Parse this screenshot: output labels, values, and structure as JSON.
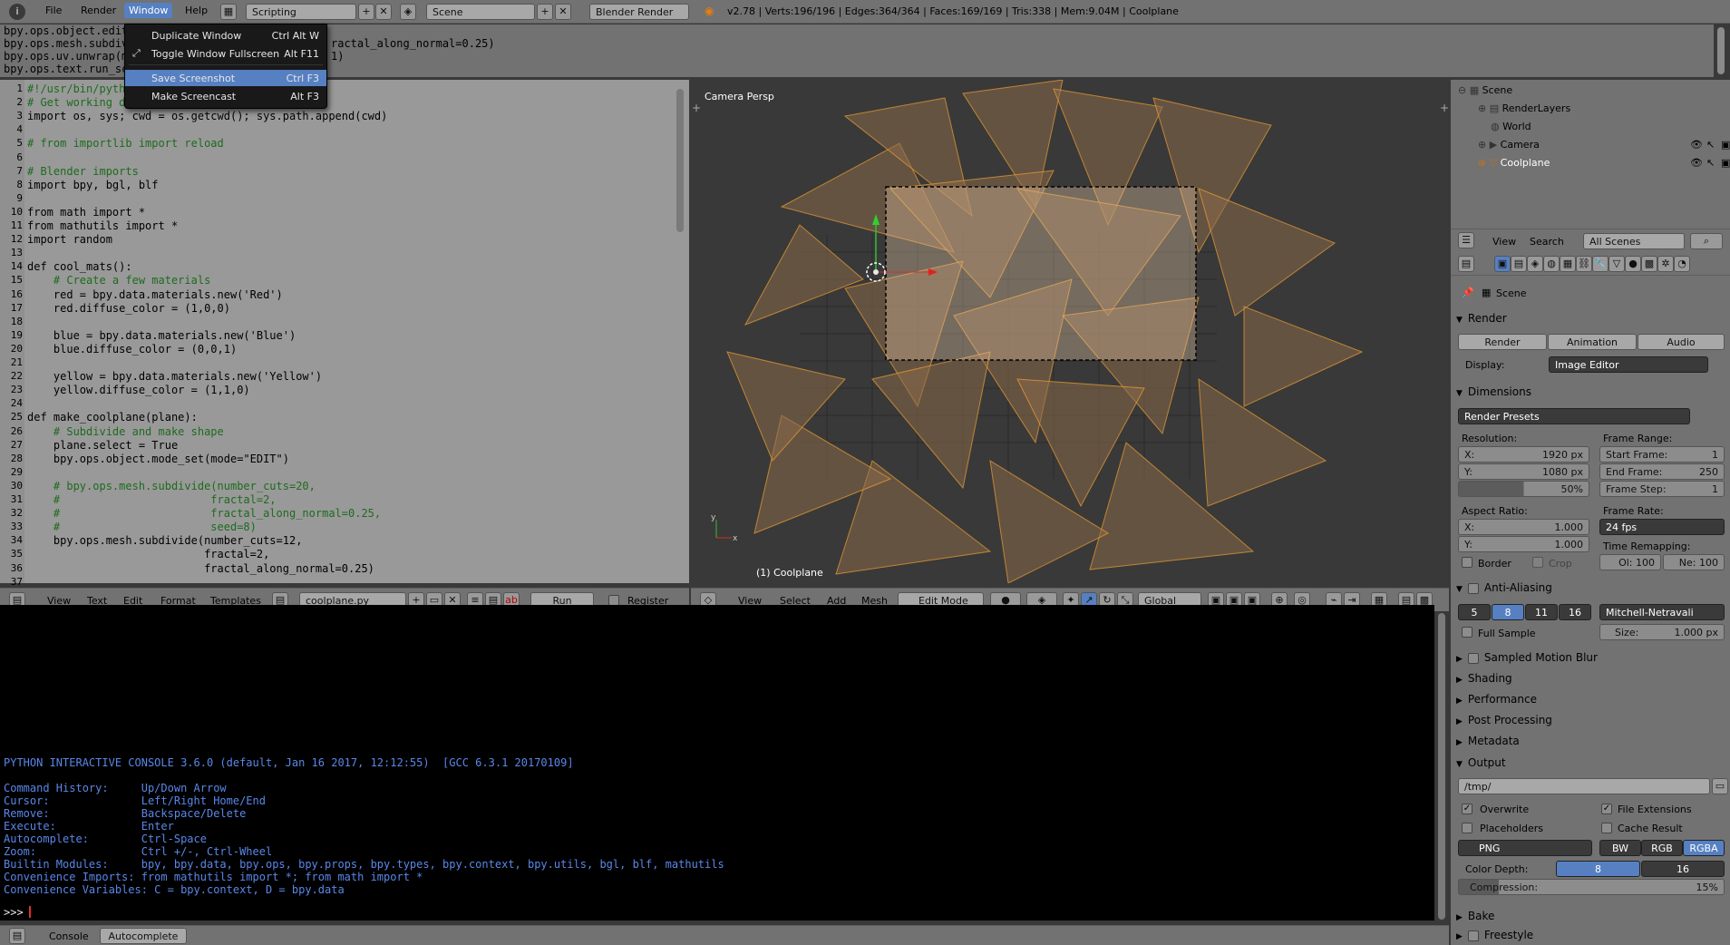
{
  "topbar": {
    "menus": [
      "File",
      "Render",
      "Window",
      "Help"
    ],
    "layout": "Scripting",
    "scene": "Scene",
    "engine": "Blender Render",
    "stats": "v2.78 | Verts:196/196 | Edges:364/364 | Faces:169/169 | Tris:338 | Mem:9.04M | Coolplane"
  },
  "info_log": [
    "bpy.ops.object.edit",
    "bpy.ops.mesh.subdiv",
    "bpy.ops.uv.unwrap(m",
    "bpy.ops.text.run_sc"
  ],
  "info_log_tail": [
    "ractal_along_normal=0.25)",
    "1)"
  ],
  "window_menu": {
    "items": [
      {
        "label": "Duplicate Window",
        "shortcut": "Ctrl Alt W"
      },
      {
        "label": "Toggle Window Fullscreen",
        "shortcut": "Alt F11"
      },
      {
        "label": "Save Screenshot",
        "shortcut": "Ctrl F3"
      },
      {
        "label": "Make Screencast",
        "shortcut": "Alt F3"
      }
    ]
  },
  "text_editor": {
    "lines": [
      "#!/usr/bin/pyth",
      "# Get working d",
      "import os, sys; cwd = os.getcwd(); sys.path.append(cwd)",
      "",
      "# from importlib import reload",
      "",
      "# Blender imports",
      "import bpy, bgl, blf",
      "",
      "from math import *",
      "from mathutils import *",
      "import random",
      "",
      "def cool_mats():",
      "    # Create a few materials",
      "    red = bpy.data.materials.new('Red')",
      "    red.diffuse_color = (1,0,0)",
      "",
      "    blue = bpy.data.materials.new('Blue')",
      "    blue.diffuse_color = (0,0,1)",
      "",
      "    yellow = bpy.data.materials.new('Yellow')",
      "    yellow.diffuse_color = (1,1,0)",
      "",
      "def make_coolplane(plane):",
      "    # Subdivide and make shape",
      "    plane.select = True",
      "    bpy.ops.object.mode_set(mode=\"EDIT\")",
      "",
      "    # bpy.ops.mesh.subdivide(number_cuts=20,",
      "    #                       fractal=2,",
      "    #                       fractal_along_normal=0.25,",
      "    #                       seed=8)",
      "    bpy.ops.mesh.subdivide(number_cuts=12,",
      "                           fractal=2,",
      "                           fractal_along_normal=0.25)",
      ""
    ],
    "line_numbers": [
      "1",
      "2",
      "3",
      "4",
      "5",
      "6",
      "7",
      "8",
      "9",
      "10",
      "11",
      "12",
      "13",
      "14",
      "15",
      "16",
      "17",
      "18",
      "19",
      "20",
      "21",
      "22",
      "23",
      "24",
      "25",
      "26",
      "27",
      "28",
      "29",
      "30",
      "31",
      "32",
      "33",
      "34",
      "35",
      "36",
      "37"
    ],
    "header": {
      "menus": [
        "View",
        "Text",
        "Edit",
        "Format",
        "Templates"
      ],
      "filename": "coolplane.py",
      "run_script": "Run Script",
      "register": "Register"
    }
  },
  "viewport": {
    "label": "Camera Persp",
    "object_label": "(1) Coolplane",
    "header": {
      "menus": [
        "View",
        "Select",
        "Add",
        "Mesh"
      ],
      "mode": "Edit Mode",
      "orientation": "Global"
    }
  },
  "console": {
    "lines": [
      "PYTHON INTERACTIVE CONSOLE 3.6.0 (default, Jan 16 2017, 12:12:55)  [GCC 6.3.1 20170109]",
      "",
      "Command History:     Up/Down Arrow",
      "Cursor:              Left/Right Home/End",
      "Remove:              Backspace/Delete",
      "Execute:             Enter",
      "Autocomplete:        Ctrl-Space",
      "Zoom:                Ctrl +/-, Ctrl-Wheel",
      "Builtin Modules:     bpy, bpy.data, bpy.ops, bpy.props, bpy.types, bpy.context, bpy.utils, bgl, blf, mathutils",
      "Convenience Imports: from mathutils import *; from math import *",
      "Convenience Variables: C = bpy.context, D = bpy.data"
    ],
    "prompt": ">>> ",
    "header": {
      "console": "Console",
      "autocomplete": "Autocomplete"
    }
  },
  "outliner": {
    "items": [
      "Scene",
      "RenderLayers",
      "World",
      "Camera",
      "Coolplane"
    ],
    "header": {
      "view": "View",
      "search": "Search",
      "filter": "All Scenes"
    }
  },
  "properties": {
    "context": "Scene",
    "render_section": "Render",
    "render_buttons": [
      "Render",
      "Animation",
      "Audio"
    ],
    "display_label": "Display:",
    "display_value": "Image Editor",
    "dimensions": "Dimensions",
    "render_presets": "Render Presets",
    "resolution_label": "Resolution:",
    "res_x": "X:",
    "res_x_val": "1920 px",
    "res_y": "Y:",
    "res_y_val": "1080 px",
    "res_pct": "50%",
    "frame_range_label": "Frame Range:",
    "start_frame": "Start Frame:",
    "start_val": "1",
    "end_frame": "End Frame:",
    "end_val": "250",
    "frame_step": "Frame Step:",
    "step_val": "1",
    "aspect_label": "Aspect Ratio:",
    "aspect_x_val": "1.000",
    "aspect_y_val": "1.000",
    "frame_rate_label": "Frame Rate:",
    "fps": "24 fps",
    "time_remap_label": "Time Remapping:",
    "ol": "Ol:",
    "ol_val": "100",
    "ne": "Ne:",
    "ne_val": "100",
    "border": "Border",
    "crop": "Crop",
    "anti_aliasing": "Anti-Aliasing",
    "aa_samples": [
      "5",
      "8",
      "11",
      "16"
    ],
    "aa_filter": "Mitchell-Netravali",
    "full_sample": "Full Sample",
    "size_label": "Size:",
    "size_val": "1.000 px",
    "collapsed": [
      "Sampled Motion Blur",
      "Shading",
      "Performance",
      "Post Processing",
      "Metadata"
    ],
    "output": "Output",
    "output_path": "/tmp/",
    "overwrite": "Overwrite",
    "file_ext": "File Extensions",
    "placeholders": "Placeholders",
    "cache_result": "Cache Result",
    "format": "PNG",
    "color_modes": [
      "BW",
      "RGB",
      "RGBA"
    ],
    "color_depth_label": "Color Depth:",
    "depth_8": "8",
    "depth_16": "16",
    "compression": "Compression:",
    "compression_val": "15%",
    "compression_level": 0.15,
    "bake": "Bake",
    "freestyle": "Freestyle"
  },
  "colors": {
    "accent": "#5680c2",
    "mesh": "#f0a030",
    "console_text": "#5a87e8"
  }
}
